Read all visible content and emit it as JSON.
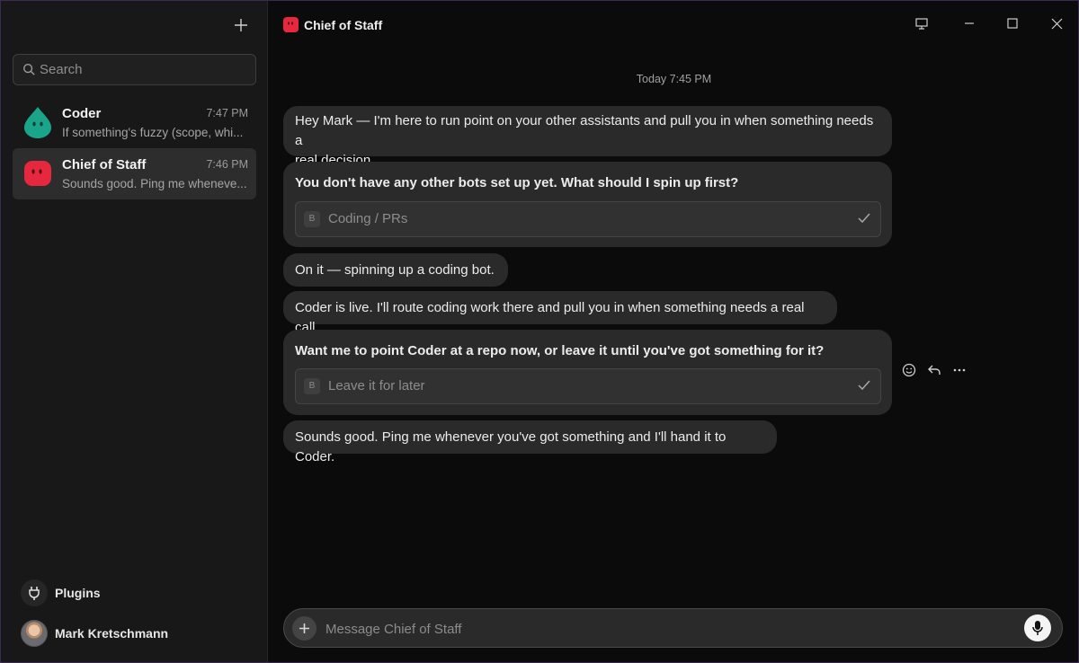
{
  "sidebar": {
    "search_placeholder": "Search",
    "conversations": [
      {
        "name": "Coder",
        "time": "7:47 PM",
        "preview": "If something's fuzzy (scope, whi...",
        "avatar_color": "#1aa58a"
      },
      {
        "name": "Chief of Staff",
        "time": "7:46 PM",
        "preview": "Sounds good. Ping me wheneve...",
        "avatar_color": "#e5283d"
      }
    ],
    "plugins_label": "Plugins",
    "user_name": "Mark Kretschmann"
  },
  "header": {
    "title": "Chief of Staff",
    "icons": [
      "monitor-icon",
      "minimize-icon",
      "maximize-icon",
      "close-icon"
    ]
  },
  "chat": {
    "date_separator": "Today 7:45 PM",
    "messages": [
      {
        "text_line1": "Hey Mark — I'm here to run point on your other assistants and pull you in when something needs a",
        "text_line2": "real decision."
      },
      {
        "question": "You don't have any other bots set up yet. What should I spin up first?",
        "choice_key": "B",
        "choice_value": "Coding / PRs"
      },
      {
        "text": "On it — spinning up a coding bot."
      },
      {
        "text": "Coder is live. I'll route coding work there and pull you in when something needs a real call."
      },
      {
        "question": "Want me to point Coder at a repo now, or leave it until you've got something for it?",
        "choice_key": "B",
        "choice_value": "Leave it for later"
      },
      {
        "text": "Sounds good. Ping me whenever you've got something and I'll hand it to Coder."
      }
    ],
    "message_actions": [
      "emoji-icon",
      "reply-icon",
      "more-icon"
    ]
  },
  "composer": {
    "placeholder": "Message Chief of Staff"
  },
  "colors": {
    "accent_red": "#e5283d",
    "accent_teal": "#1aa58a",
    "window_border": "#3a2a55"
  }
}
